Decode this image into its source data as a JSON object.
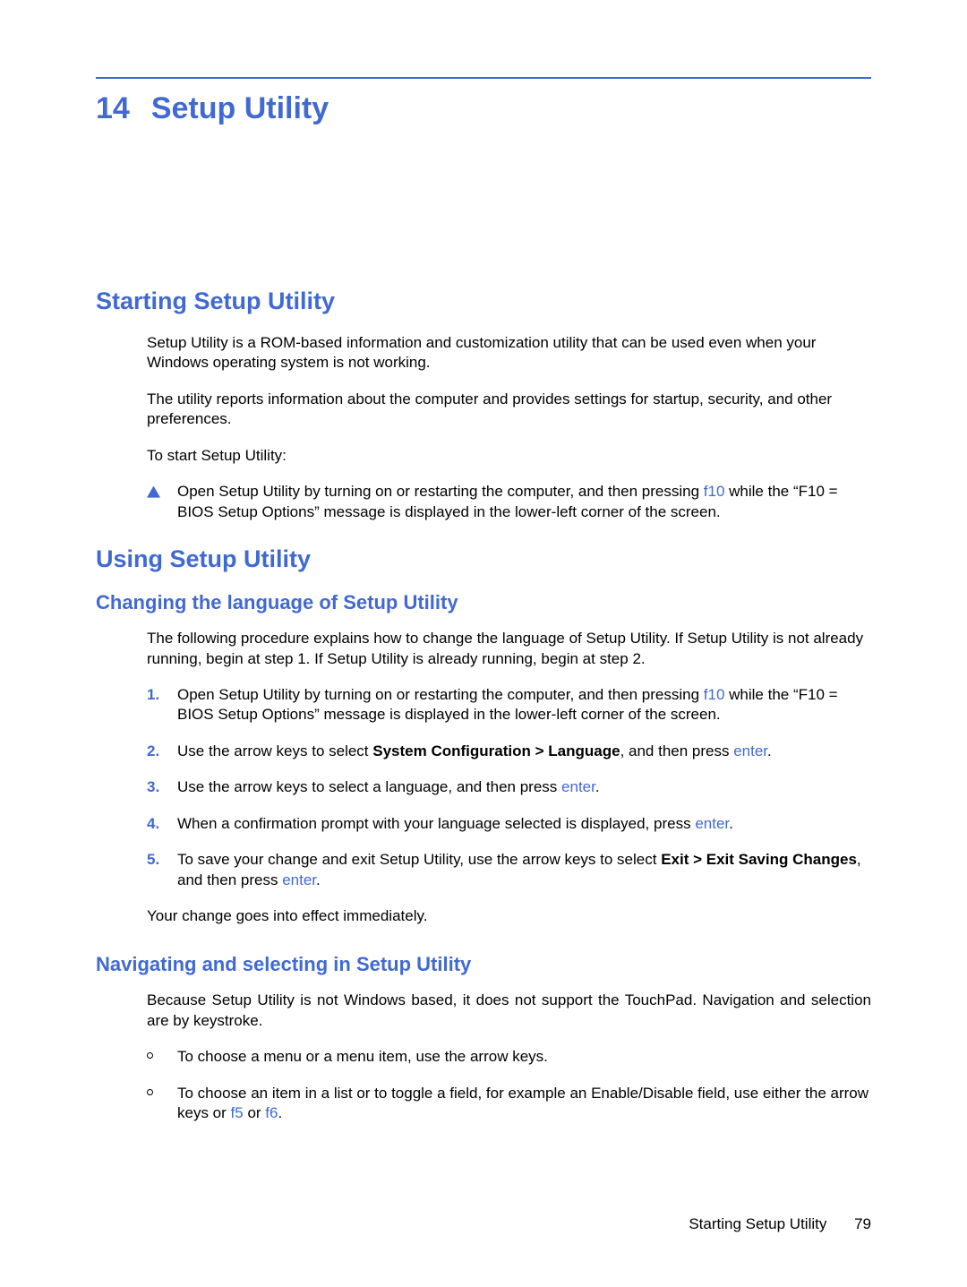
{
  "chapter": {
    "number": "14",
    "title": "Setup Utility"
  },
  "section_starting": {
    "heading": "Starting Setup Utility",
    "para1": "Setup Utility is a ROM-based information and customization utility that can be used even when your Windows operating system is not working.",
    "para2": "The utility reports information about the computer and provides settings for startup, security, and other preferences.",
    "para3": "To start Setup Utility:",
    "step_pre": "Open Setup Utility by turning on or restarting the computer, and then pressing ",
    "step_key": "f10",
    "step_post": " while the “F10 = BIOS Setup Options” message is displayed in the lower-left corner of the screen."
  },
  "section_using": {
    "heading": "Using Setup Utility",
    "sub_lang": {
      "heading": "Changing the language of Setup Utility",
      "intro": "The following procedure explains how to change the language of Setup Utility. If Setup Utility is not already running, begin at step 1. If Setup Utility is already running, begin at step 2.",
      "steps": {
        "s1_pre": "Open Setup Utility by turning on or restarting the computer, and then pressing ",
        "s1_key": "f10",
        "s1_post": " while the “F10 = BIOS Setup Options” message is displayed in the lower-left corner of the screen.",
        "s2_pre": "Use the arrow keys to select ",
        "s2_bold": "System Configuration > Language",
        "s2_mid": ", and then press ",
        "s2_key": "enter",
        "s2_post": ".",
        "s3_pre": "Use the arrow keys to select a language, and then press ",
        "s3_key": "enter",
        "s3_post": ".",
        "s4_pre": "When a confirmation prompt with your language selected is displayed, press ",
        "s4_key": "enter",
        "s4_post": ".",
        "s5_pre": "To save your change and exit Setup Utility, use the arrow keys to select ",
        "s5_bold": "Exit > Exit Saving Changes",
        "s5_mid": ", and then press ",
        "s5_key": "enter",
        "s5_post": "."
      },
      "outro": "Your change goes into effect immediately."
    },
    "sub_nav": {
      "heading": "Navigating and selecting in Setup Utility",
      "intro": "Because Setup Utility is not Windows based, it does not support the TouchPad. Navigation and selection are by keystroke.",
      "bullets": {
        "b1": "To choose a menu or a menu item, use the arrow keys.",
        "b2_pre": "To choose an item in a list or to toggle a field, for example an Enable/Disable field, use either the arrow keys or ",
        "b2_key1": "f5",
        "b2_mid": " or ",
        "b2_key2": "f6",
        "b2_post": "."
      }
    }
  },
  "footer": {
    "section_name": "Starting Setup Utility",
    "page_number": "79"
  },
  "labels": {
    "n1": "1.",
    "n2": "2.",
    "n3": "3.",
    "n4": "4.",
    "n5": "5."
  }
}
